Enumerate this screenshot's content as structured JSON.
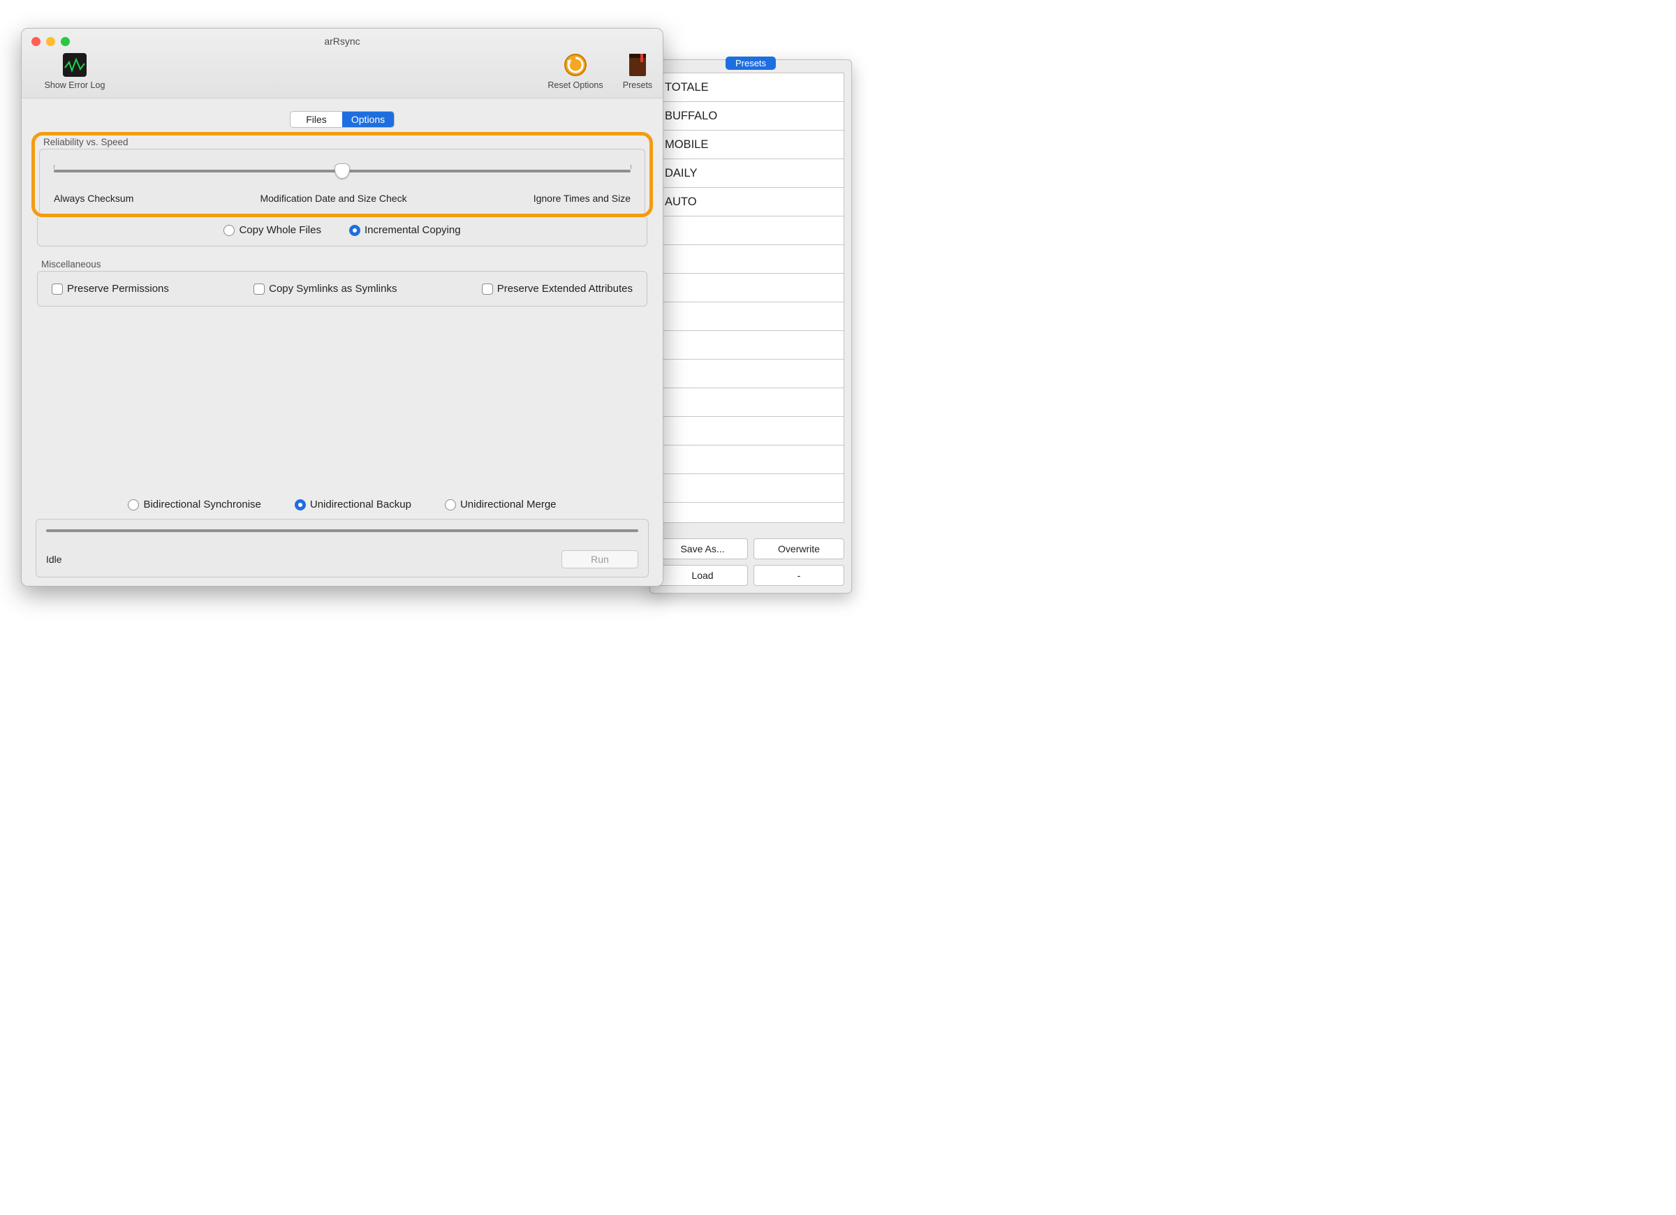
{
  "window": {
    "title": "arRsync"
  },
  "toolbar": {
    "error_log_label": "Show Error Log",
    "reset_label": "Reset Options",
    "presets_label": "Presets"
  },
  "tabs": {
    "files": "Files",
    "options": "Options",
    "active": "options"
  },
  "reliability": {
    "group_label": "Reliability vs. Speed",
    "slider_value_percent": 50,
    "labels": {
      "left": "Always Checksum",
      "center": "Modification Date and Size Check",
      "right": "Ignore Times and Size"
    },
    "copy_mode": {
      "whole": "Copy Whole Files",
      "incremental": "Incremental Copying",
      "selected": "incremental"
    }
  },
  "misc": {
    "group_label": "Miscellaneous",
    "preserve_permissions": {
      "label": "Preserve Permissions",
      "checked": false
    },
    "copy_symlinks": {
      "label": "Copy Symlinks as Symlinks",
      "checked": false
    },
    "preserve_xattr": {
      "label": "Preserve Extended Attributes",
      "checked": false
    }
  },
  "sync_mode": {
    "bidirectional": "Bidirectional Synchronise",
    "uni_backup": "Unidirectional Backup",
    "uni_merge": "Unidirectional Merge",
    "selected": "uni_backup"
  },
  "status": {
    "text": "Idle",
    "run_label": "Run"
  },
  "presets_panel": {
    "title": "Presets",
    "items": [
      "TOTALE",
      "BUFFALO",
      "MOBILE",
      "DAILY",
      "AUTO"
    ],
    "visible_rows": 15,
    "buttons": {
      "save_as": "Save As...",
      "overwrite": "Overwrite",
      "load": "Load",
      "delete": "-"
    }
  }
}
